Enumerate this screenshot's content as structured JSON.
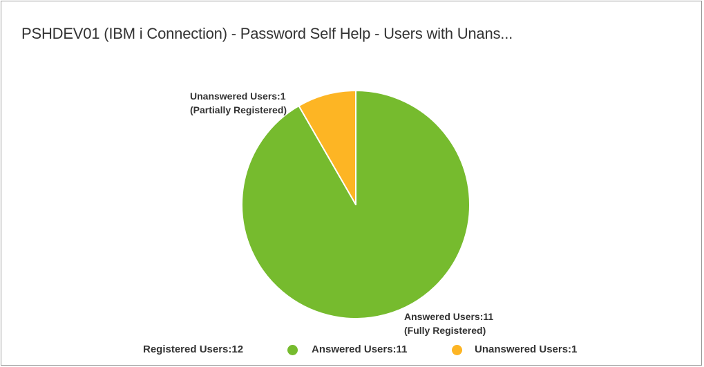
{
  "panel": {
    "title": "PSHDEV01 (IBM i Connection) - Password Self Help - Users with Unans..."
  },
  "chart_data": {
    "type": "pie",
    "title": "PSHDEV01 (IBM i Connection) - Password Self Help - Users with Unans...",
    "slices": [
      {
        "name": "Answered Users",
        "value": 11,
        "label_line1": "Answered Users:11",
        "label_line2": "(Fully Registered)",
        "color": "#76bb2e"
      },
      {
        "name": "Unanswered Users",
        "value": 1,
        "label_line1": "Unanswered Users:1",
        "label_line2": "(Partially Registered)",
        "color": "#fdb524"
      }
    ],
    "legend": {
      "placement": "bottom-center",
      "total_label": "Registered Users:12",
      "items": [
        "Answered Users:11",
        "Unanswered Users:1"
      ]
    }
  }
}
